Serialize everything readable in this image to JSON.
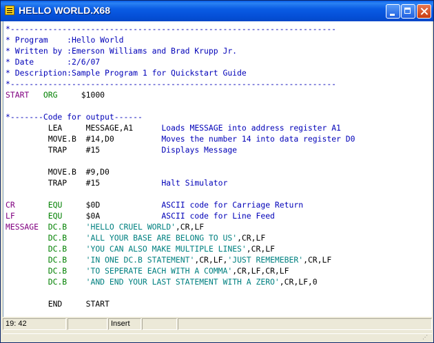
{
  "window": {
    "title": "HELLO WORLD.X68"
  },
  "code_lines": [
    [
      {
        "t": "*---------------------------------------------------------------------",
        "c": "c"
      }
    ],
    [
      {
        "t": "* Program    :Hello World",
        "c": "c"
      }
    ],
    [
      {
        "t": "* Written by :Emerson Williams and Brad Krupp Jr.",
        "c": "c"
      }
    ],
    [
      {
        "t": "* Date       :2/6/07",
        "c": "c"
      }
    ],
    [
      {
        "t": "* Description:Sample Program 1 for Quickstart Guide",
        "c": "c"
      }
    ],
    [
      {
        "t": "*---------------------------------------------------------------------",
        "c": "c"
      }
    ],
    [
      {
        "t": "START",
        "c": "l"
      },
      {
        "t": "   ",
        "c": "o"
      },
      {
        "t": "ORG",
        "c": "k"
      },
      {
        "t": "     $1000",
        "c": "o"
      }
    ],
    [
      {
        "t": "",
        "c": "o"
      }
    ],
    [
      {
        "t": "*-------Code for output------",
        "c": "c"
      }
    ],
    [
      {
        "t": "         LEA     MESSAGE,A1      ",
        "c": "o"
      },
      {
        "t": "Loads MESSAGE into address register A1",
        "c": "c"
      }
    ],
    [
      {
        "t": "         MOVE.B  #14,D0          ",
        "c": "o"
      },
      {
        "t": "Moves the number 14 into data register D0",
        "c": "c"
      }
    ],
    [
      {
        "t": "         TRAP    #15             ",
        "c": "o"
      },
      {
        "t": "Displays Message",
        "c": "c"
      }
    ],
    [
      {
        "t": "",
        "c": "o"
      }
    ],
    [
      {
        "t": "         MOVE.B  #9,D0",
        "c": "o"
      }
    ],
    [
      {
        "t": "         TRAP    #15             ",
        "c": "o"
      },
      {
        "t": "Halt Simulator",
        "c": "c"
      }
    ],
    [
      {
        "t": "",
        "c": "o"
      }
    ],
    [
      {
        "t": "CR",
        "c": "l"
      },
      {
        "t": "       ",
        "c": "o"
      },
      {
        "t": "EQU",
        "c": "k"
      },
      {
        "t": "     $0D             ",
        "c": "o"
      },
      {
        "t": "ASCII code for Carriage Return",
        "c": "c"
      }
    ],
    [
      {
        "t": "LF",
        "c": "l"
      },
      {
        "t": "       ",
        "c": "o"
      },
      {
        "t": "EQU",
        "c": "k"
      },
      {
        "t": "     $0A             ",
        "c": "o"
      },
      {
        "t": "ASCII code for Line Feed",
        "c": "c"
      }
    ],
    [
      {
        "t": "MESSAGE",
        "c": "l"
      },
      {
        "t": "  ",
        "c": "o"
      },
      {
        "t": "DC.B",
        "c": "k"
      },
      {
        "t": "    ",
        "c": "o"
      },
      {
        "t": "'HELLO CRUEL WORLD'",
        "c": "s"
      },
      {
        "t": ",CR,LF",
        "c": "o"
      }
    ],
    [
      {
        "t": "         ",
        "c": "o"
      },
      {
        "t": "DC.B",
        "c": "k"
      },
      {
        "t": "    ",
        "c": "o"
      },
      {
        "t": "'ALL YOUR BASE ARE BELONG TO US'",
        "c": "s"
      },
      {
        "t": ",CR,LF",
        "c": "o"
      }
    ],
    [
      {
        "t": "         ",
        "c": "o"
      },
      {
        "t": "DC.B",
        "c": "k"
      },
      {
        "t": "    ",
        "c": "o"
      },
      {
        "t": "'YOU CAN ALSO MAKE MULTIPLE LINES'",
        "c": "s"
      },
      {
        "t": ",CR,LF",
        "c": "o"
      }
    ],
    [
      {
        "t": "         ",
        "c": "o"
      },
      {
        "t": "DC.B",
        "c": "k"
      },
      {
        "t": "    ",
        "c": "o"
      },
      {
        "t": "'IN ONE DC.B STATEMENT'",
        "c": "s"
      },
      {
        "t": ",CR,LF,",
        "c": "o"
      },
      {
        "t": "'JUST REMEMEBER'",
        "c": "s"
      },
      {
        "t": ",CR,LF",
        "c": "o"
      }
    ],
    [
      {
        "t": "         ",
        "c": "o"
      },
      {
        "t": "DC.B",
        "c": "k"
      },
      {
        "t": "    ",
        "c": "o"
      },
      {
        "t": "'TO SEPERATE EACH WITH A COMMA'",
        "c": "s"
      },
      {
        "t": ",CR,LF,CR,LF",
        "c": "o"
      }
    ],
    [
      {
        "t": "         ",
        "c": "o"
      },
      {
        "t": "DC.B",
        "c": "k"
      },
      {
        "t": "    ",
        "c": "o"
      },
      {
        "t": "'AND END YOUR LAST STATEMENT WITH A ZERO'",
        "c": "s"
      },
      {
        "t": ",CR,LF,0",
        "c": "o"
      }
    ],
    [
      {
        "t": "",
        "c": "o"
      }
    ],
    [
      {
        "t": "         END     START",
        "c": "o"
      }
    ]
  ],
  "status": {
    "position": "19: 42",
    "field2": "",
    "mode": "Insert",
    "field4": "",
    "field5": ""
  },
  "colors": {
    "comment": "#0000b8",
    "label": "#800080",
    "directive": "#008000",
    "string": "#008080",
    "title_bar": "#0550d8"
  },
  "icons": {
    "app": "editor-document-icon",
    "minimize": "minimize-icon",
    "maximize": "maximize-icon",
    "close": "close-icon"
  }
}
